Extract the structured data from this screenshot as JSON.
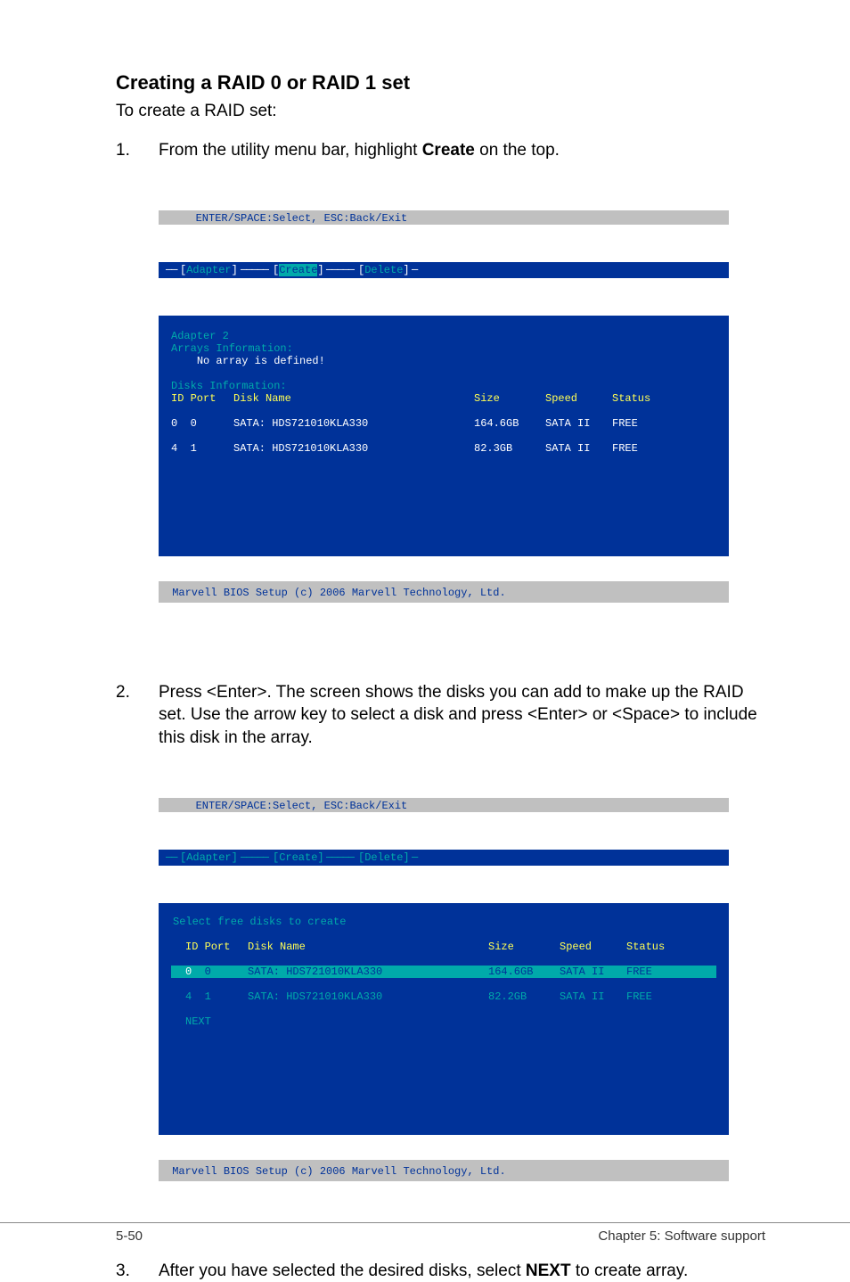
{
  "heading": "Creating a RAID 0 or RAID 1 set",
  "intro": "To create a RAID set:",
  "steps": {
    "1": {
      "num": "1.",
      "text_a": "From the utility menu bar, highlight ",
      "bold": "Create",
      "text_b": " on the top."
    },
    "2": {
      "num": "2.",
      "text": "Press <Enter>. The screen shows the disks you can add to make up the RAID set. Use the arrow key to select a disk and press <Enter> or <Space> to include this disk in the array."
    },
    "3": {
      "num": "3.",
      "text_a": "After you have selected the desired disks, select ",
      "bold": "NEXT",
      "text_b": " to create array."
    }
  },
  "bios1": {
    "hint": "ENTER/SPACE:Select, ESC:Back/Exit",
    "tabs": {
      "adapter": "Adapter",
      "create": "Create",
      "delete": "Delete"
    },
    "adapter_line": "Adapter 2",
    "arrays_info": "Arrays Information:",
    "no_array": "No array is defined!",
    "disks_info": "Disks Information:",
    "head": {
      "idport": "ID Port",
      "name": "Disk Name",
      "size": "Size",
      "speed": "Speed",
      "status": "Status"
    },
    "rows": [
      {
        "id": "0",
        "port": "0",
        "name": "SATA: HDS721010KLA330",
        "size": "164.6GB",
        "speed": "SATA II",
        "status": "FREE"
      },
      {
        "id": "4",
        "port": "1",
        "name": "SATA: HDS721010KLA330",
        "size": "82.3GB",
        "speed": "SATA II",
        "status": "FREE"
      }
    ],
    "footer": "Marvell BIOS Setup (c) 2006 Marvell Technology, Ltd."
  },
  "bios2": {
    "hint": "ENTER/SPACE:Select, ESC:Back/Exit",
    "tabs": {
      "adapter": "Adapter",
      "create": "Create",
      "delete": "Delete"
    },
    "popup_title": "Select free disks to create",
    "head": {
      "idport": "ID Port",
      "name": "Disk Name",
      "size": "Size",
      "speed": "Speed",
      "status": "Status"
    },
    "rows": [
      {
        "id": "0",
        "port": "0",
        "name": "SATA: HDS721010KLA330",
        "size": "164.6GB",
        "speed": "SATA II",
        "status": "FREE"
      },
      {
        "id": "4",
        "port": "1",
        "name": "SATA: HDS721010KLA330",
        "size": "82.2GB",
        "speed": "SATA II",
        "status": "FREE"
      }
    ],
    "next": "NEXT",
    "footer": "Marvell BIOS Setup (c) 2006 Marvell Technology, Ltd."
  },
  "footer": {
    "left": "5-50",
    "right": "Chapter 5: Software support"
  }
}
